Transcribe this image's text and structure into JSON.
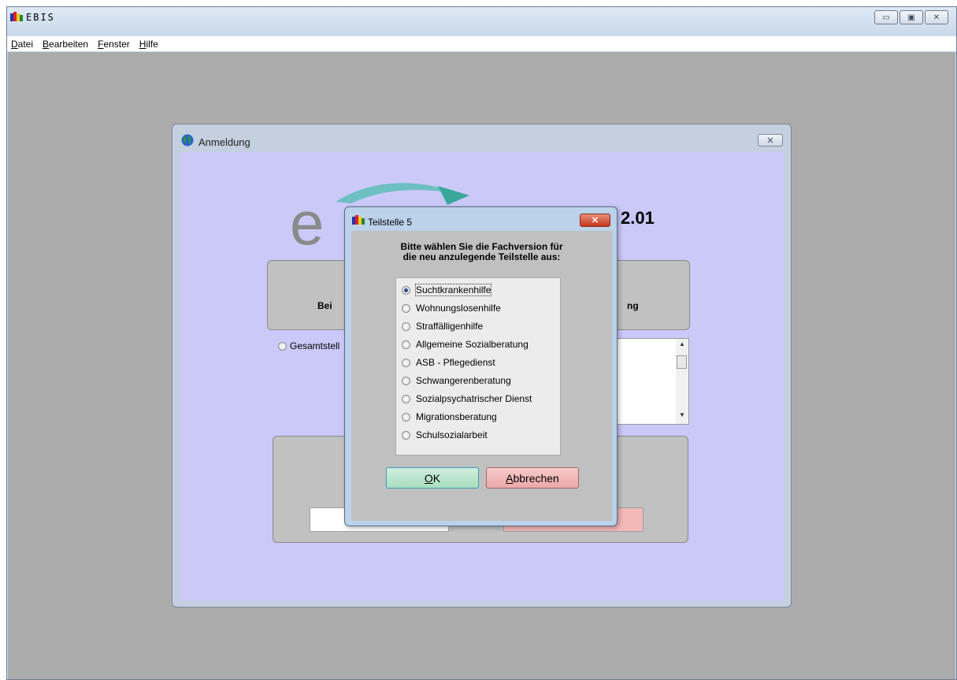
{
  "main_window": {
    "title": "EBIS",
    "menu": [
      {
        "access": "D",
        "rest": "atei"
      },
      {
        "access": "B",
        "rest": "earbeiten"
      },
      {
        "access": "F",
        "rest": "enster"
      },
      {
        "access": "H",
        "rest": "ilfe"
      }
    ],
    "controls": {
      "minimize": "▭",
      "maximize": "▣",
      "close": "✕"
    }
  },
  "login_window": {
    "title": "Anmeldung",
    "close": "✕",
    "logo_text": "e",
    "version": "2.01",
    "group_left_label": "Bei",
    "group_right_label": "ng",
    "gesamt_label": "Gesamtstell"
  },
  "dialog": {
    "title": "Teilstelle 5",
    "close": "✕",
    "prompt_line1": "Bitte wählen Sie die Fachversion für",
    "prompt_line2": "die neu anzulegende Teilstelle aus:",
    "options": [
      {
        "label": "Suchtkrankenhilfe",
        "checked": true
      },
      {
        "label": "Wohnungslosenhilfe",
        "checked": false
      },
      {
        "label": "Straffälligenhilfe",
        "checked": false
      },
      {
        "label": "Allgemeine Sozialberatung",
        "checked": false
      },
      {
        "label": "ASB - Pflegedienst",
        "checked": false
      },
      {
        "label": "Schwangerenberatung",
        "checked": false
      },
      {
        "label": "Sozialpsychatrischer Dienst",
        "checked": false
      },
      {
        "label": "Migrationsberatung",
        "checked": false
      },
      {
        "label": "Schulsozialarbeit",
        "checked": false
      }
    ],
    "ok_access": "O",
    "ok_rest": "K",
    "cancel_access": "A",
    "cancel_rest": "bbrechen"
  }
}
